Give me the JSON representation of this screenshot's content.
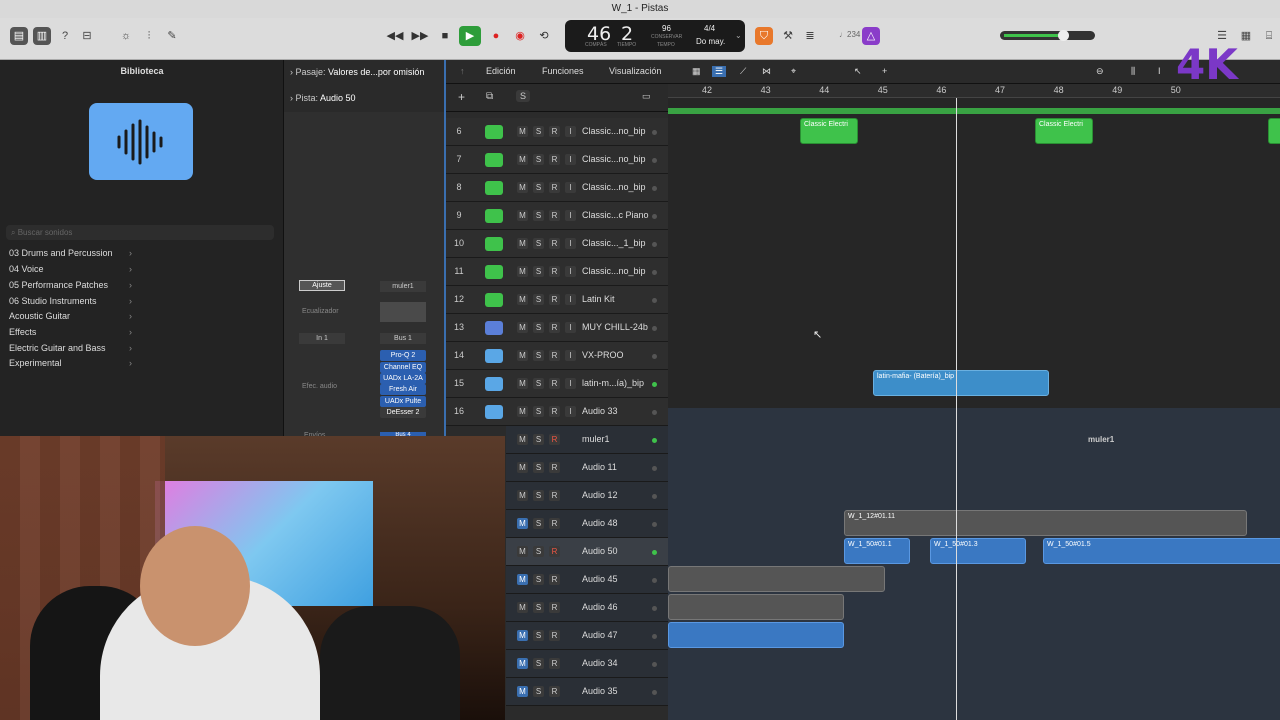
{
  "window": {
    "title": "W_1 - Pistas"
  },
  "lcd": {
    "bar": "46",
    "beat": "2",
    "bar_label": "COMPÁS",
    "beat_label": "TIEMPO",
    "tempo": "96",
    "tempo_label": "CONSERVAR",
    "tempo_sub": "TEMPO",
    "time_sig": "4/4",
    "key": "Do may."
  },
  "toolbar": {
    "count_in": "♩234"
  },
  "library": {
    "title": "Biblioteca",
    "search_placeholder": "Buscar sonidos",
    "items": [
      "03 Drums and Percussion",
      "04 Voice",
      "05 Performance Patches",
      "06 Studio Instruments",
      "Acoustic Guitar",
      "Effects",
      "Electric Guitar and Bass",
      "Experimental"
    ]
  },
  "inspector": {
    "region_label": "Pasaje:",
    "region_value": "Valores de...por omisión",
    "track_label": "Pista:",
    "track_value": "Audio 50",
    "setting": "Ajuste",
    "eq": "Ecualizador",
    "input": "In 1",
    "fx": "Efec. audio",
    "sends": "Envíos",
    "strip_name": "muler1",
    "bus": "Bus 1",
    "bus4": "Bus 4",
    "plugins": [
      "Pro-Q 2",
      "Channel EQ",
      "UADx LA-2A",
      "Fresh Air",
      "UADx Pulte",
      "DeEsser 2"
    ]
  },
  "menus": {
    "edit": "Edición",
    "functions": "Funciones",
    "view": "Visualización"
  },
  "ruler": {
    "bars": [
      "42",
      "43",
      "44",
      "45",
      "46",
      "47",
      "48",
      "49",
      "50"
    ]
  },
  "tracks": [
    {
      "num": "6",
      "name": "Classic...no_bip",
      "type": "midi",
      "m": false,
      "r": false,
      "dot": "grey"
    },
    {
      "num": "7",
      "name": "Classic...no_bip",
      "type": "midi",
      "m": false,
      "r": false,
      "dot": "grey"
    },
    {
      "num": "8",
      "name": "Classic...no_bip",
      "type": "midi",
      "m": false,
      "r": false,
      "dot": "grey"
    },
    {
      "num": "9",
      "name": "Classic...c Piano",
      "type": "midi",
      "m": false,
      "r": false,
      "dot": "grey"
    },
    {
      "num": "10",
      "name": "Classic..._1_bip",
      "type": "midi",
      "m": false,
      "r": false,
      "dot": "grey"
    },
    {
      "num": "11",
      "name": "Classic...no_bip",
      "type": "midi",
      "m": false,
      "r": false,
      "dot": "grey"
    },
    {
      "num": "12",
      "name": "Latin Kit",
      "type": "drum",
      "m": false,
      "r": false,
      "dot": "grey"
    },
    {
      "num": "13",
      "name": "MUY CHILL-24b",
      "type": "bluedrum",
      "m": false,
      "r": false,
      "dot": "grey"
    },
    {
      "num": "14",
      "name": "VX-PROO",
      "type": "audio",
      "m": false,
      "r": false,
      "dot": "grey"
    },
    {
      "num": "15",
      "name": "latin-m...ía)_bip",
      "type": "audio",
      "m": false,
      "r": false,
      "dot": "green"
    },
    {
      "num": "16",
      "name": "Audio 33",
      "type": "audio",
      "m": false,
      "r": false,
      "dot": "grey"
    },
    {
      "num": "",
      "name": "muler1",
      "type": "none",
      "m": false,
      "r": true,
      "dot": "green"
    },
    {
      "num": "",
      "name": "Audio 11",
      "type": "none",
      "m": false,
      "r": false,
      "dot": "grey"
    },
    {
      "num": "",
      "name": "Audio 12",
      "type": "none",
      "m": false,
      "r": false,
      "dot": "grey"
    },
    {
      "num": "",
      "name": "Audio 48",
      "type": "none",
      "m": true,
      "r": false,
      "dot": "grey"
    },
    {
      "num": "",
      "name": "Audio 50",
      "type": "none",
      "m": false,
      "r": true,
      "dot": "green"
    },
    {
      "num": "",
      "name": "Audio 45",
      "type": "none",
      "m": true,
      "r": false,
      "dot": "grey"
    },
    {
      "num": "",
      "name": "Audio 46",
      "type": "none",
      "m": false,
      "r": false,
      "dot": "grey"
    },
    {
      "num": "",
      "name": "Audio 47",
      "type": "none",
      "m": true,
      "r": false,
      "dot": "grey"
    },
    {
      "num": "",
      "name": "Audio 34",
      "type": "none",
      "m": true,
      "r": false,
      "dot": "grey"
    },
    {
      "num": "",
      "name": "Audio 35",
      "type": "none",
      "m": true,
      "r": false,
      "dot": "grey"
    }
  ],
  "regions": {
    "classic1": "Classic Electri",
    "classic2": "Classic Electri",
    "latin": "latin-mafia- (Batería)_bip",
    "summing": "muler1",
    "w12": "W_1_12#01.11",
    "w50_1": "W_1_50#01.1",
    "w50_3": "W_1_50#01.3",
    "w50_5": "W_1_50#01.5"
  },
  "logo": "4K",
  "colors": {
    "midi": "#3fc24b",
    "audio": "#3d8ec9",
    "accent": "#3a6fb0",
    "logo": "#7b38c7"
  }
}
